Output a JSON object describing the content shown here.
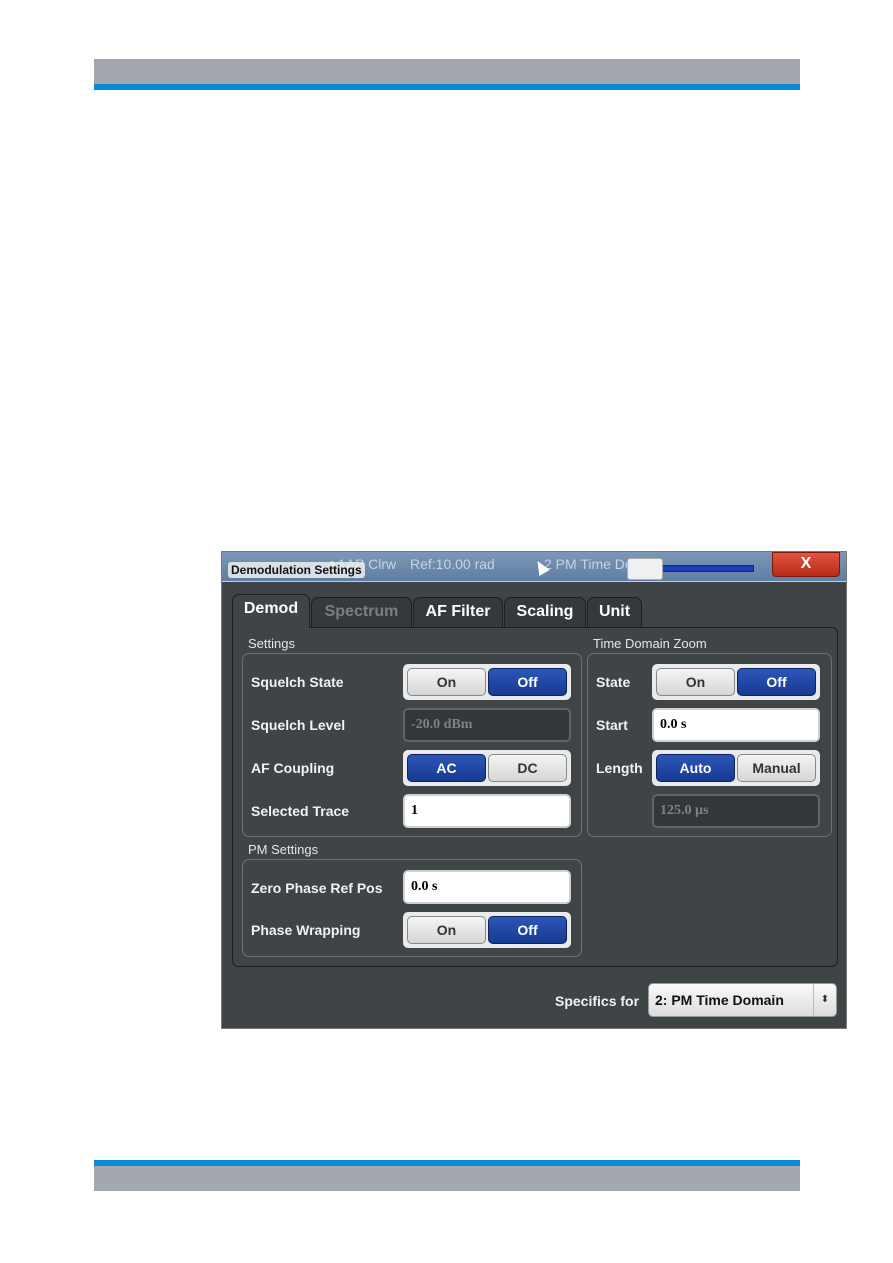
{
  "colors": {
    "accent_blue": "#0a8bd0",
    "header_gray": "#a2a8ad",
    "dialog_bg": "#3f4446",
    "toggle_selected": "#1f44a3",
    "close_red": "#cf3f2a"
  },
  "background_display": {
    "trace1_label": "1AP Clrw",
    "ref_label": "Ref:10.00 rad",
    "trace2_label": "2 PM Time Domain"
  },
  "dialog": {
    "title": "Demodulation Settings",
    "close_label": "X",
    "tabs": [
      {
        "label": "Demod",
        "active": true,
        "enabled": true
      },
      {
        "label": "Spectrum",
        "active": false,
        "enabled": false
      },
      {
        "label": "AF Filter",
        "active": false,
        "enabled": true
      },
      {
        "label": "Scaling",
        "active": false,
        "enabled": true
      },
      {
        "label": "Unit",
        "active": false,
        "enabled": true
      }
    ],
    "settings": {
      "group_label": "Settings",
      "squelch_state": {
        "label": "Squelch State",
        "options": [
          "On",
          "Off"
        ],
        "selected": "Off"
      },
      "squelch_level": {
        "label": "Squelch Level",
        "value": "-20.0 dBm",
        "enabled": false
      },
      "af_coupling": {
        "label": "AF Coupling",
        "options": [
          "AC",
          "DC"
        ],
        "selected": "AC"
      },
      "selected_trace": {
        "label": "Selected Trace",
        "value": "1"
      }
    },
    "time_domain_zoom": {
      "group_label": "Time Domain Zoom",
      "state": {
        "label": "State",
        "options": [
          "On",
          "Off"
        ],
        "selected": "Off"
      },
      "start": {
        "label": "Start",
        "value": "0.0 s"
      },
      "length": {
        "label": "Length",
        "options": [
          "Auto",
          "Manual"
        ],
        "selected": "Auto",
        "value": "125.0 µs",
        "enabled": false
      }
    },
    "pm_settings": {
      "group_label": "PM Settings",
      "zero_phase_ref_pos": {
        "label": "Zero Phase Ref Pos",
        "value": "0.0 s"
      },
      "phase_wrapping": {
        "label": "Phase Wrapping",
        "options": [
          "On",
          "Off"
        ],
        "selected": "Off"
      }
    },
    "specifics_for": {
      "label": "Specifics for",
      "value": "2: PM Time Domain",
      "arrow_icon": "⬍"
    }
  }
}
